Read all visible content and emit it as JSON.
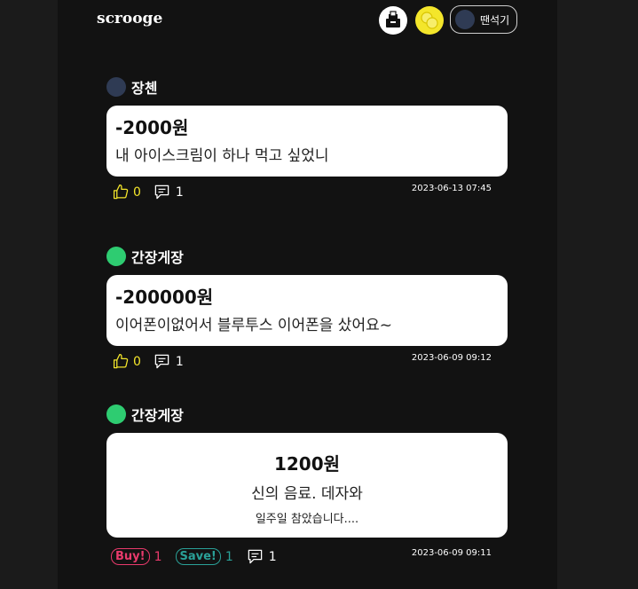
{
  "app": {
    "brand": "scrooge"
  },
  "header": {
    "write_icon": "money-box-icon",
    "coins_icon": "coins-icon",
    "profile_name": "땐석기",
    "profile_avatar_color": "#2f3b54"
  },
  "posts": [
    {
      "author": "장첸",
      "avatar_color": "#2f3b54",
      "amount": "-2000원",
      "title": "내 아이스크림이 하나 먹고 싶었니",
      "likes": "0",
      "comments": "1",
      "date": "2023-06-13 07:45"
    },
    {
      "author": "간장게장",
      "avatar_color": "#2ecc71",
      "amount": "-200000원",
      "title": "이어폰이없어서 블루투스 이어폰을 샀어요~",
      "likes": "0",
      "comments": "1",
      "date": "2023-06-09 09:12"
    },
    {
      "author": "간장게장",
      "avatar_color": "#2ecc71",
      "amount": "1200원",
      "title": "신의 음료. 데자와",
      "subtitle": "일주일 참았습니다....",
      "buy_label": "Buy!",
      "buy_count": "1",
      "save_label": "Save!",
      "save_count": "1",
      "comments": "1",
      "date": "2023-06-09 09:11"
    }
  ],
  "colors": {
    "accent_yellow": "#f4e62b",
    "buy_pink": "#e83a6c",
    "save_teal": "#2aa198"
  }
}
